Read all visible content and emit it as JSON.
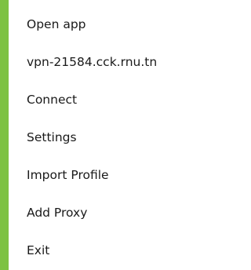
{
  "theme": {
    "accent": "#7dc242",
    "background": "#ffffff",
    "text": "#1a1a1a"
  },
  "menu": {
    "items": [
      {
        "label": "Open app"
      },
      {
        "label": "vpn-21584.cck.rnu.tn"
      },
      {
        "label": "Connect"
      },
      {
        "label": "Settings"
      },
      {
        "label": "Import Profile"
      },
      {
        "label": "Add Proxy"
      },
      {
        "label": "Exit"
      }
    ]
  }
}
